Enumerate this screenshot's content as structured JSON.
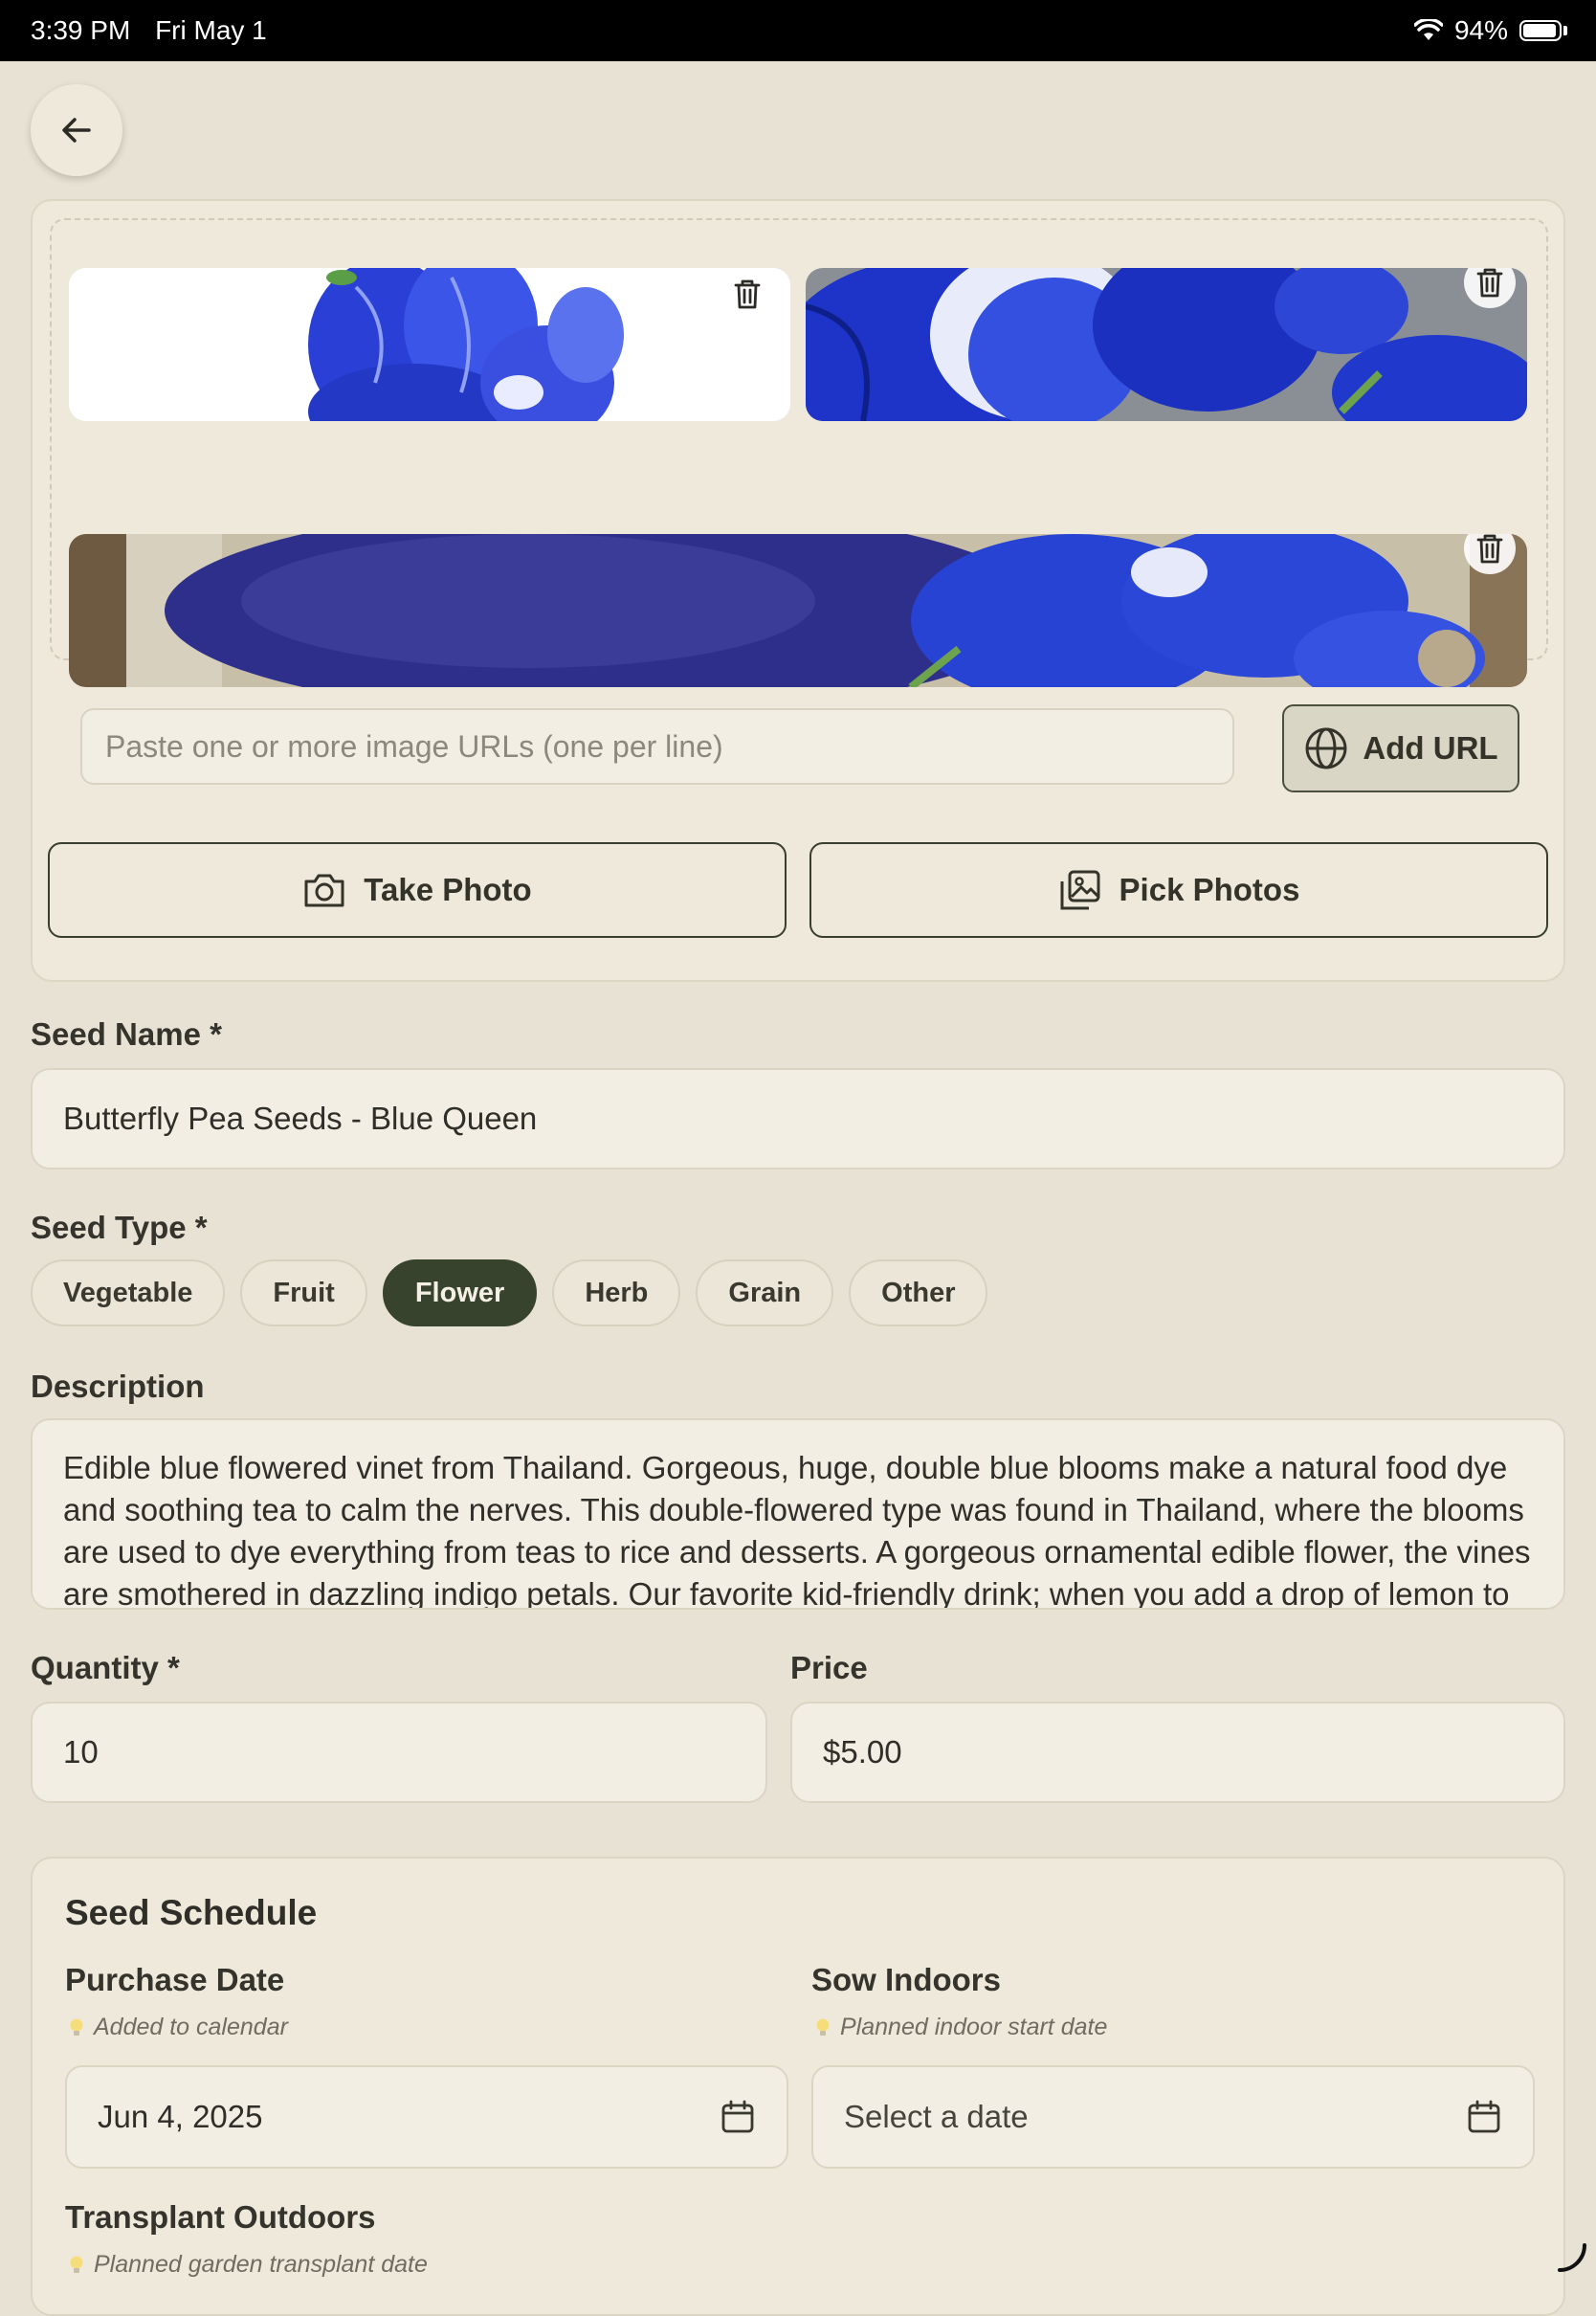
{
  "status_bar": {
    "time": "3:39 PM",
    "date": "Fri May 1",
    "battery": "94%"
  },
  "photos": {
    "url_placeholder": "Paste one or more image URLs (one per line)",
    "add_url_label": "Add URL",
    "take_photo_label": "Take Photo",
    "pick_photos_label": "Pick Photos"
  },
  "seed_name": {
    "label": "Seed Name *",
    "value": "Butterfly Pea Seeds - Blue Queen"
  },
  "seed_type": {
    "label": "Seed Type *",
    "options": [
      "Vegetable",
      "Fruit",
      "Flower",
      "Herb",
      "Grain",
      "Other"
    ],
    "selected": "Flower"
  },
  "description": {
    "label": "Description",
    "value": "Edible blue flowered vinet from Thailand. Gorgeous, huge, double blue blooms make a natural food dye and soothing tea to calm the nerves. This double-flowered type was found in Thailand, where the blooms are used to dye everything from teas to rice and desserts. A gorgeous ornamental edible flower, the vines are smothered in dazzling indigo petals. Our favorite kid-friendly drink; when you add a drop of lemon to"
  },
  "quantity": {
    "label": "Quantity *",
    "value": "10"
  },
  "price": {
    "label": "Price",
    "value": "$5.00"
  },
  "schedule": {
    "title": "Seed Schedule",
    "purchase_date": {
      "label": "Purchase Date",
      "hint": "Added to calendar",
      "value": "Jun 4, 2025"
    },
    "sow_indoors": {
      "label": "Sow Indoors",
      "hint": "Planned indoor start date",
      "value": "Select a date"
    },
    "transplant_outdoors": {
      "label": "Transplant Outdoors",
      "hint": "Planned garden transplant date"
    }
  },
  "colors": {
    "background": "#E8E2D4",
    "accent": "#37432C",
    "flower_blue": "#1F3FD8"
  }
}
